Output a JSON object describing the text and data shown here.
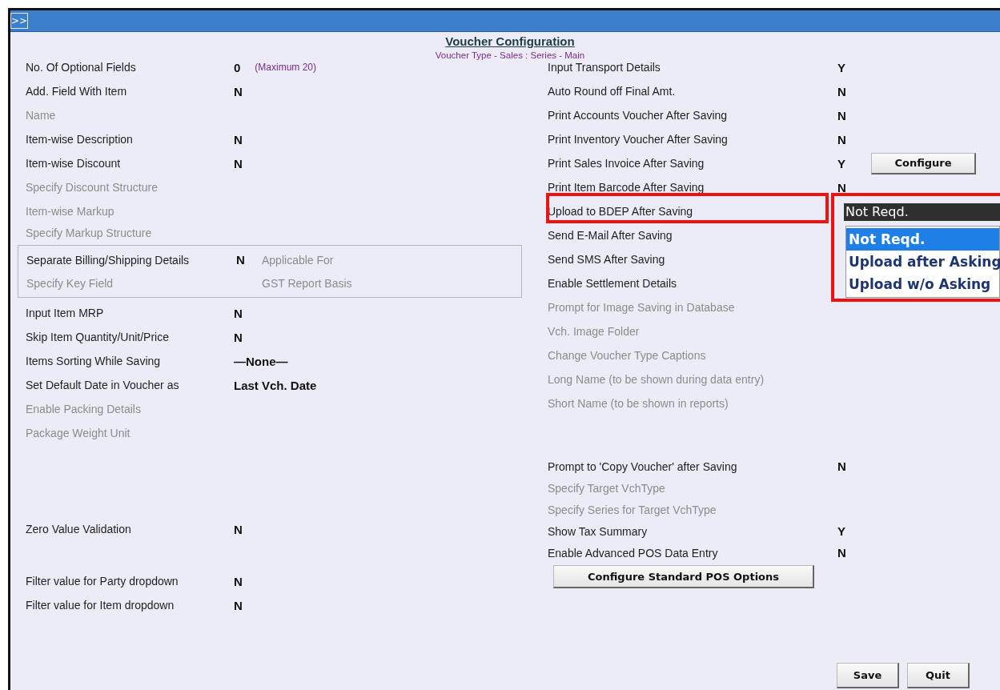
{
  "window": {
    "expand_button": ">>"
  },
  "heading": {
    "title": "Voucher Configuration",
    "subtitle": "Voucher Type - Sales  :  Series - Main"
  },
  "left_top": [
    {
      "label": "No. Of Optional Fields",
      "value": "0",
      "note": "(Maximum 20)",
      "enabled": true
    },
    {
      "label": "Add. Field With Item",
      "value": "N",
      "enabled": true
    },
    {
      "label": "Name",
      "enabled": false
    },
    {
      "label": "Item-wise Description",
      "value": "N",
      "enabled": true
    },
    {
      "label": "Item-wise Discount",
      "value": "N",
      "enabled": true
    },
    {
      "label": "Specify Discount Structure",
      "enabled": false
    },
    {
      "label": "Item-wise Markup",
      "enabled": false
    },
    {
      "label": "Specify Markup Structure",
      "enabled": false
    }
  ],
  "left_group": [
    {
      "label": "Separate Billing/Shipping Details",
      "value": "N",
      "enabled": true,
      "side_label": "Applicable For",
      "side_enabled": false
    },
    {
      "label": "Specify Key Field",
      "enabled": false,
      "side_label": "GST Report Basis",
      "side_enabled": false
    }
  ],
  "left_bottom": [
    {
      "label": "Input Item MRP",
      "value": "N",
      "enabled": true
    },
    {
      "label": "Skip Item Quantity/Unit/Price",
      "value": "N",
      "enabled": true
    },
    {
      "label": "Items Sorting While Saving",
      "value": "—None—",
      "enabled": true
    },
    {
      "label": "Set Default Date in Voucher as",
      "value": "Last Vch. Date",
      "enabled": true
    },
    {
      "label": "Enable Packing Details",
      "enabled": false
    },
    {
      "label": "Package Weight Unit",
      "enabled": false
    },
    {
      "label": "Zero Value Validation",
      "value": "N",
      "enabled": true
    },
    {
      "label": "Filter value for Party dropdown",
      "value": "N",
      "enabled": true
    },
    {
      "label": "Filter value for Item dropdown",
      "value": "N",
      "enabled": true
    }
  ],
  "right": [
    {
      "label": "Input Transport Details",
      "value": "Y",
      "enabled": true
    },
    {
      "label": "Auto Round off Final Amt.",
      "value": "N",
      "enabled": true
    },
    {
      "label": "Print Accounts Voucher After Saving",
      "value": "N",
      "enabled": true
    },
    {
      "label": "Print Inventory Voucher After Saving",
      "value": "N",
      "enabled": true
    },
    {
      "label": "Print Sales Invoice After Saving",
      "value": "Y",
      "enabled": true,
      "button": "Configure"
    },
    {
      "label": "Print Item Barcode After Saving",
      "value": "N",
      "enabled": true
    },
    {
      "label": "Upload to BDEP After Saving",
      "enabled": true,
      "highlighted": true,
      "dropdown": {
        "value": "Not Reqd.",
        "options": [
          {
            "label": "Not Reqd.",
            "selected": true
          },
          {
            "label": "Upload after Asking",
            "selected": false
          },
          {
            "label": "Upload w/o Asking",
            "selected": false
          }
        ]
      }
    },
    {
      "label": "Send E-Mail After Saving",
      "enabled": true
    },
    {
      "label": "Send SMS After Saving",
      "enabled": true
    },
    {
      "label": "Enable Settlement Details",
      "enabled": true
    },
    {
      "label": "Prompt for Image Saving in Database",
      "enabled": false
    },
    {
      "label": "Vch. Image Folder",
      "enabled": false
    },
    {
      "label": "Change Voucher Type Captions",
      "enabled": false
    },
    {
      "label": "Long Name (to be shown during data entry)",
      "enabled": false
    },
    {
      "label": "Short Name (to be shown in reports)",
      "enabled": false
    },
    {
      "label": "Prompt to 'Copy Voucher' after Saving",
      "value": "N",
      "enabled": true
    },
    {
      "label": "Specify Target VchType",
      "enabled": false
    },
    {
      "label": "Specify Series for Target VchType",
      "enabled": false
    },
    {
      "label": "Show Tax Summary",
      "value": "Y",
      "enabled": true
    },
    {
      "label": "Enable Advanced POS Data Entry",
      "value": "N",
      "enabled": true
    }
  ],
  "pos_button": "Configure Standard POS Options",
  "buttons": [
    "Save",
    "Quit"
  ]
}
